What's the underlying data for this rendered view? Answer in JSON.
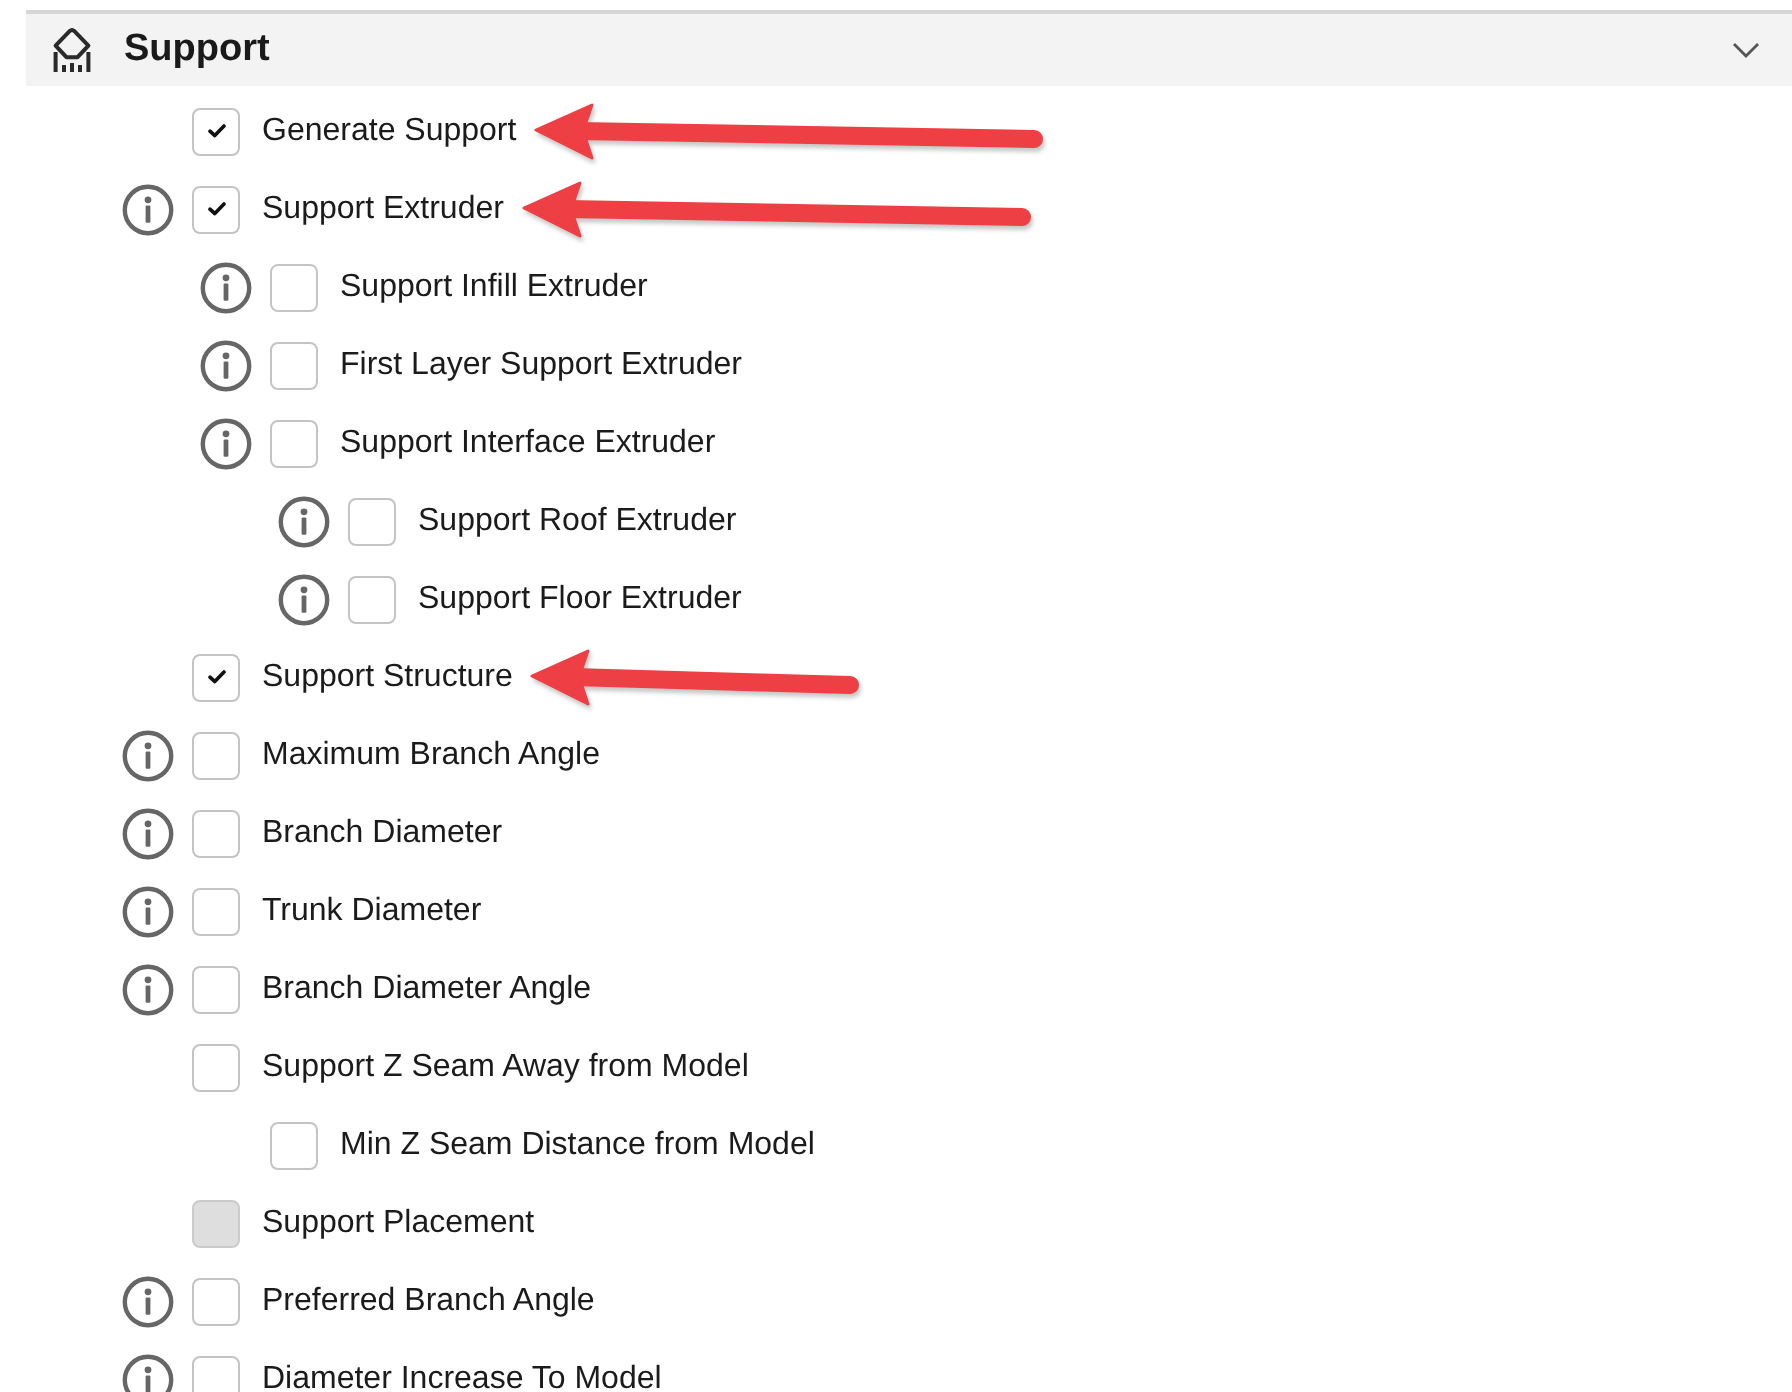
{
  "section": {
    "title": "Support",
    "expanded": true
  },
  "settings": [
    {
      "label": "Generate Support",
      "checked": true,
      "info": false,
      "disabled": false,
      "arrow": {
        "kind": "long"
      }
    },
    {
      "label": "Support Extruder",
      "checked": true,
      "info": true,
      "disabled": false,
      "arrow": {
        "kind": "long"
      },
      "children": [
        {
          "label": "Support Infill Extruder",
          "checked": false,
          "info": true,
          "disabled": false
        },
        {
          "label": "First Layer Support Extruder",
          "checked": false,
          "info": true,
          "disabled": false
        },
        {
          "label": "Support Interface Extruder",
          "checked": false,
          "info": true,
          "disabled": false,
          "children": [
            {
              "label": "Support Roof Extruder",
              "checked": false,
              "info": true,
              "disabled": false
            },
            {
              "label": "Support Floor Extruder",
              "checked": false,
              "info": true,
              "disabled": false
            }
          ]
        }
      ]
    },
    {
      "label": "Support Structure",
      "checked": true,
      "info": false,
      "disabled": false,
      "arrow": {
        "kind": "short"
      }
    },
    {
      "label": "Maximum Branch Angle",
      "checked": false,
      "info": true,
      "disabled": false
    },
    {
      "label": "Branch Diameter",
      "checked": false,
      "info": true,
      "disabled": false
    },
    {
      "label": "Trunk Diameter",
      "checked": false,
      "info": true,
      "disabled": false
    },
    {
      "label": "Branch Diameter Angle",
      "checked": false,
      "info": true,
      "disabled": false
    },
    {
      "label": "Support Z Seam Away from Model",
      "checked": false,
      "info": false,
      "disabled": false,
      "children": [
        {
          "label": "Min Z Seam Distance from Model",
          "checked": false,
          "info": false,
          "disabled": false
        }
      ]
    },
    {
      "label": "Support Placement",
      "checked": false,
      "info": false,
      "disabled": true
    },
    {
      "label": "Preferred Branch Angle",
      "checked": false,
      "info": true,
      "disabled": false
    },
    {
      "label": "Diameter Increase To Model",
      "checked": false,
      "info": true,
      "disabled": false
    }
  ]
}
